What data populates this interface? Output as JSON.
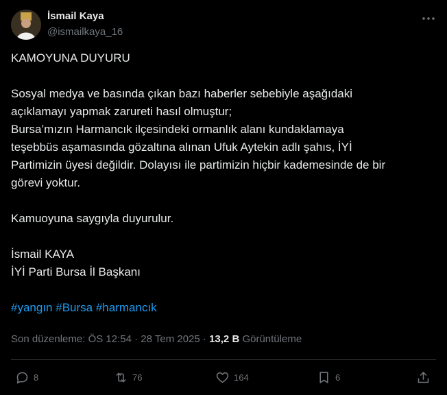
{
  "author": {
    "name": "İsmail Kaya",
    "handle": "@ismailkaya_16"
  },
  "content": {
    "lines": [
      "KAMOYUNA DUYURU",
      "",
      "Sosyal medya ve basında çıkan bazı haberler sebebiyle aşağıdaki",
      "açıklamayı yapmak zarureti hasıl olmuştur;",
      "Bursa’mızın Harmancık ilçesindeki ormanlık alanı kundaklamaya",
      "teşebbüs aşamasında gözaltına alınan Ufuk Aytekin adlı şahıs, İYİ",
      "Partimizin üyesi değildir. Dolayısı ile partimizin hiçbir kademesinde de bir",
      "görevi yoktur.",
      "",
      "Kamuoyuna saygıyla duyurulur.",
      "",
      "İsmail KAYA",
      "İYİ Parti Bursa İl Başkanı",
      ""
    ],
    "hashtags": [
      "#yangın",
      "#Bursa",
      "#harmancık"
    ]
  },
  "meta": {
    "edited": "Son düzenleme: ÖS 12:54 · 28 Tem 2025 · ",
    "views_count": "13,2 B",
    "views_label": " Görüntüleme"
  },
  "actions": {
    "replies": "8",
    "reposts": "76",
    "likes": "164",
    "bookmarks": "6"
  },
  "icons": [
    "more-icon",
    "reply-icon",
    "repost-icon",
    "like-icon",
    "bookmark-icon",
    "share-icon"
  ],
  "colors": {
    "background": "#000000",
    "text": "#e7e9ea",
    "muted": "#71767b",
    "link": "#1d9bf0",
    "divider": "#2f3336"
  }
}
